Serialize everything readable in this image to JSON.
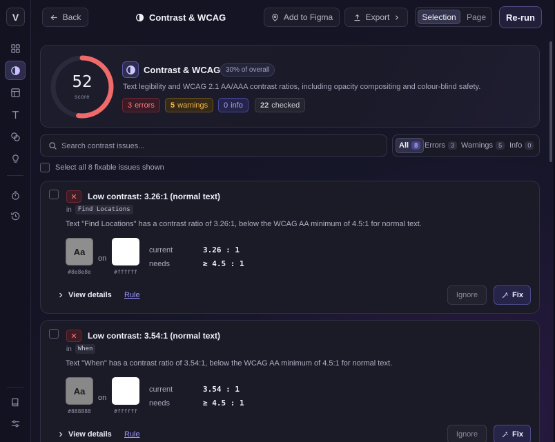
{
  "sidebar": {
    "logo": "V",
    "items": [
      {
        "icon": "grid-icon"
      },
      {
        "icon": "contrast-icon",
        "active": true
      },
      {
        "icon": "layout-icon"
      },
      {
        "icon": "type-icon"
      },
      {
        "icon": "palette-icon"
      },
      {
        "icon": "lightbulb-icon"
      },
      {
        "icon": "timer-icon"
      },
      {
        "icon": "history-icon"
      },
      {
        "icon": "book-icon"
      },
      {
        "icon": "sliders-icon"
      }
    ]
  },
  "header": {
    "back_label": "Back",
    "title": "Contrast & WCAG",
    "add_to_figma": "Add to Figma",
    "export": "Export",
    "scope_selection": "Selection",
    "scope_page": "Page",
    "rerun": "Re-run"
  },
  "summary": {
    "score": "52",
    "score_max": 100,
    "score_label": "score",
    "score_color": "#f06a6a",
    "category_title": "Contrast & WCAG",
    "overall_weight": "30% of overall",
    "description": "Text legibility and WCAG 2.1 AA/AAA contrast ratios, including opacity compositing and colour-blind safety.",
    "errors_count": "3",
    "errors_label": "errors",
    "warnings_count": "5",
    "warnings_label": "warnings",
    "info_count": "0",
    "info_label": "info",
    "checked_count": "22",
    "checked_label": "checked"
  },
  "search": {
    "placeholder": "Search contrast issues..."
  },
  "filters": [
    {
      "label": "All",
      "count": "8",
      "active": true
    },
    {
      "label": "Errors",
      "count": "3"
    },
    {
      "label": "Warnings",
      "count": "5"
    },
    {
      "label": "Info",
      "count": "0"
    }
  ],
  "select_all_label": "Select all 8 fixable issues shown",
  "issues": [
    {
      "title": "Low contrast: 3.26:1 (normal text)",
      "in_label": "in",
      "layer": "Find Locations",
      "description": "Text \"Find Locations\" has a contrast ratio of 3.26:1, below the WCAG AA minimum of 4.5:1 for normal text.",
      "swatch_text": "Aa",
      "fg_hex": "#8e8e8e",
      "bg_hex": "#ffffff",
      "on_label": "on",
      "current_label": "current",
      "current_value": "3.26 : 1",
      "needs_label": "needs",
      "needs_value": "≥ 4.5 : 1",
      "details_label": "View details",
      "rule_label": "Rule",
      "ignore_label": "Ignore",
      "fix_label": "Fix"
    },
    {
      "title": "Low contrast: 3.54:1 (normal text)",
      "in_label": "in",
      "layer": "When",
      "description": "Text \"When\" has a contrast ratio of 3.54:1, below the WCAG AA minimum of 4.5:1 for normal text.",
      "swatch_text": "Aa",
      "fg_hex": "#888888",
      "bg_hex": "#ffffff",
      "on_label": "on",
      "current_label": "current",
      "current_value": "3.54 : 1",
      "needs_label": "needs",
      "needs_value": "≥ 4.5 : 1",
      "details_label": "View details",
      "rule_label": "Rule",
      "ignore_label": "Ignore",
      "fix_label": "Fix"
    }
  ]
}
